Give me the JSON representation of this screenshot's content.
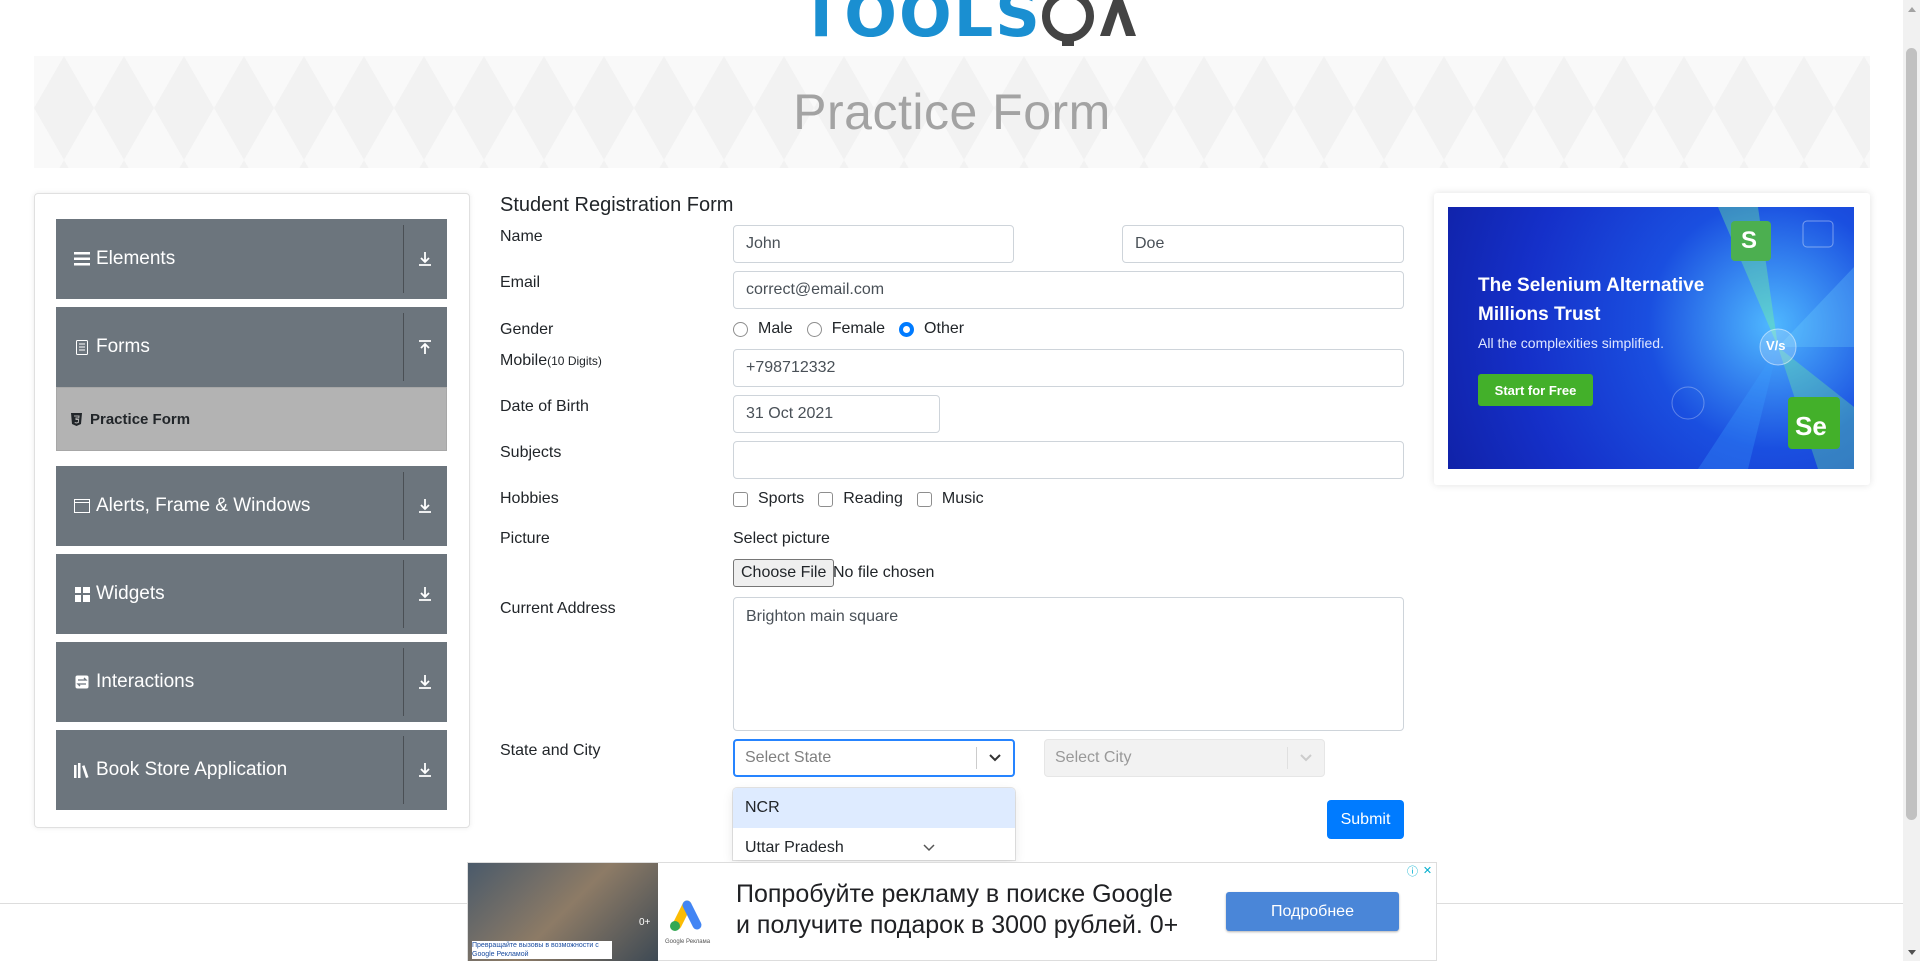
{
  "logo": {
    "text": "TOOLS",
    "suffix": "QA"
  },
  "banner": {
    "title": "Practice Form"
  },
  "sidebar": {
    "groups": [
      {
        "label": "Elements",
        "icon": "menu-icon",
        "state": "collapsed"
      },
      {
        "label": "Forms",
        "icon": "document-icon",
        "state": "expanded"
      },
      {
        "label": "Alerts, Frame & Windows",
        "icon": "window-icon",
        "state": "collapsed"
      },
      {
        "label": "Widgets",
        "icon": "grid-icon",
        "state": "collapsed"
      },
      {
        "label": "Interactions",
        "icon": "interaction-icon",
        "state": "collapsed"
      },
      {
        "label": "Book Store Application",
        "icon": "books-icon",
        "state": "collapsed"
      }
    ],
    "active_item": {
      "label": "Practice Form",
      "icon": "html5-icon"
    }
  },
  "form": {
    "title": "Student Registration Form",
    "name": {
      "label": "Name",
      "first": "John",
      "last": "Doe"
    },
    "email": {
      "label": "Email",
      "value": "correct@email.com"
    },
    "gender": {
      "label": "Gender",
      "options": [
        "Male",
        "Female",
        "Other"
      ],
      "selected": "Other"
    },
    "mobile": {
      "label": "Mobile",
      "hint": "(10 Digits)",
      "value": "+798712332"
    },
    "dob": {
      "label": "Date of Birth",
      "value": "31 Oct 2021"
    },
    "subjects": {
      "label": "Subjects",
      "value": ""
    },
    "hobbies": {
      "label": "Hobbies",
      "options": [
        "Sports",
        "Reading",
        "Music"
      ]
    },
    "picture": {
      "label": "Picture",
      "select_label": "Select picture",
      "button": "Choose File",
      "status": "No file chosen"
    },
    "address": {
      "label": "Current Address",
      "value": "Brighton main square"
    },
    "state_city": {
      "label": "State and City",
      "state_placeholder": "Select State",
      "city_placeholder": "Select City",
      "dropdown_options": [
        "NCR",
        "Uttar Pradesh"
      ],
      "highlighted": "NCR"
    },
    "submit": "Submit"
  },
  "right_ad": {
    "title_line1": "The Selenium Alternative",
    "title_line2": "Millions Trust",
    "subtitle": "All the complexities simplified.",
    "button": "Start for Free",
    "logo_s": "S",
    "logo_vs": "V/s",
    "logo_se": "Se"
  },
  "bottom_ad": {
    "line1": "Попробуйте рекламу в поиске Google",
    "line2": "и получите подарок в 3000 рублей. 0+",
    "cta": "Подробнее",
    "photo_caption": "Превращайте вызовы в возможности с Google Рекламой",
    "badge": "0+",
    "gads_caption": "Google Реклама"
  },
  "colors": {
    "sidebar_group": "#6c757d",
    "active_item": "#b3b3b3",
    "primary": "#007bff",
    "dropdown_highlight": "#deebff",
    "ad_green": "#43b02a"
  }
}
